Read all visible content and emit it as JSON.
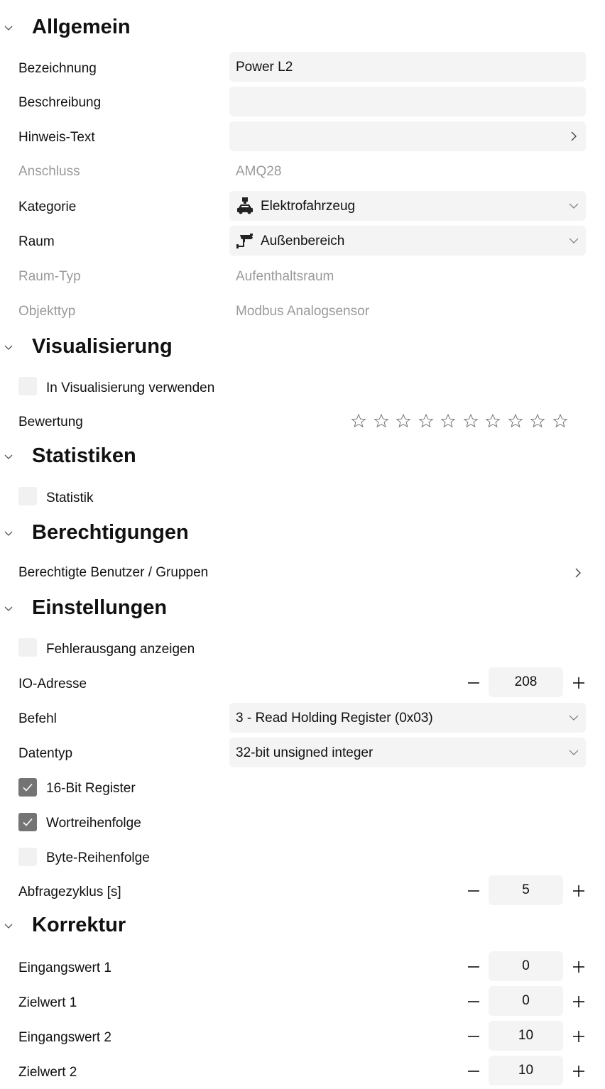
{
  "sections": {
    "allgemein": "Allgemein",
    "visualisierung": "Visualisierung",
    "statistiken": "Statistiken",
    "berechtigungen": "Berechtigungen",
    "einstellungen": "Einstellungen",
    "korrektur": "Korrektur"
  },
  "allgemein": {
    "bezeichnung_label": "Bezeichnung",
    "bezeichnung_value": "Power L2",
    "beschreibung_label": "Beschreibung",
    "beschreibung_value": "",
    "hinweis_label": "Hinweis-Text",
    "hinweis_value": "",
    "anschluss_label": "Anschluss",
    "anschluss_value": "AMQ28",
    "kategorie_label": "Kategorie",
    "kategorie_value": "Elektrofahrzeug",
    "kategorie_icon": "electric-car-charger-icon",
    "raum_label": "Raum",
    "raum_value": "Außenbereich",
    "raum_icon": "security-camera-icon",
    "raumtyp_label": "Raum-Typ",
    "raumtyp_value": "Aufenthaltsraum",
    "objekttyp_label": "Objekttyp",
    "objekttyp_value": "Modbus Analogsensor"
  },
  "visualisierung": {
    "use_label": "In Visualisierung verwenden",
    "use_checked": false,
    "bewertung_label": "Bewertung",
    "rating_max": 10,
    "rating_value": 0
  },
  "statistiken": {
    "statistik_label": "Statistik",
    "statistik_checked": false
  },
  "berechtigungen": {
    "users_label": "Berechtigte Benutzer / Gruppen"
  },
  "einstellungen": {
    "fehlerausgang_label": "Fehlerausgang anzeigen",
    "fehlerausgang_checked": false,
    "io_label": "IO-Adresse",
    "io_value": "208",
    "befehl_label": "Befehl",
    "befehl_value": "3 - Read Holding Register (0x03)",
    "datentyp_label": "Datentyp",
    "datentyp_value": "32-bit unsigned integer",
    "reg16_label": "16-Bit Register",
    "reg16_checked": true,
    "wort_label": "Wortreihenfolge",
    "wort_checked": true,
    "byte_label": "Byte-Reihenfolge",
    "byte_checked": false,
    "zyklus_label": "Abfragezyklus [s]",
    "zyklus_value": "5"
  },
  "korrektur": {
    "ein1_label": "Eingangswert 1",
    "ein1_value": "0",
    "ziel1_label": "Zielwert 1",
    "ziel1_value": "0",
    "ein2_label": "Eingangswert 2",
    "ein2_value": "10",
    "ziel2_label": "Zielwert 2",
    "ziel2_value": "10"
  }
}
